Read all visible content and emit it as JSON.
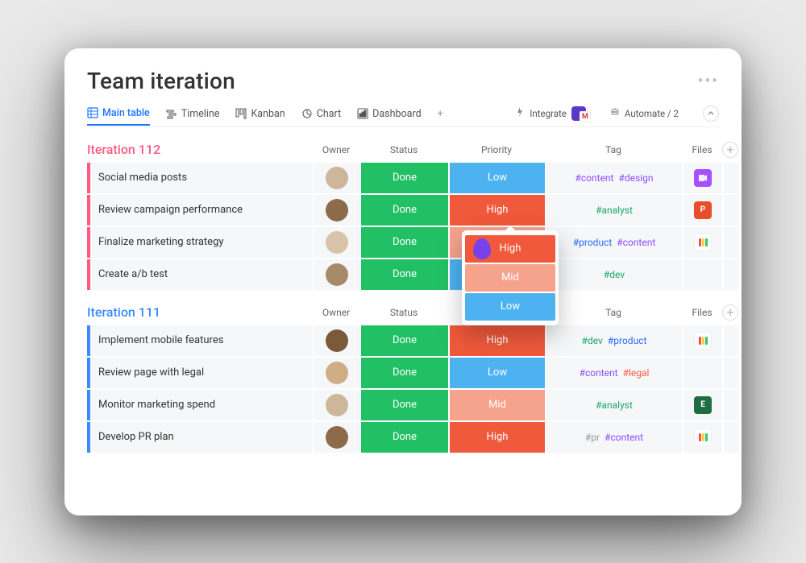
{
  "header": {
    "title": "Team iteration"
  },
  "tabs": {
    "main": "Main table",
    "timeline": "Timeline",
    "kanban": "Kanban",
    "chart": "Chart",
    "dashboard": "Dashboard"
  },
  "toolbar": {
    "integrate": "Integrate",
    "automate": "Automate / 2"
  },
  "columns": {
    "owner": "Owner",
    "status": "Status",
    "priority": "Priority",
    "tag": "Tag",
    "files": "Files"
  },
  "priority_options": {
    "high": "High",
    "mid": "Mid",
    "low": "Low"
  },
  "groups": [
    {
      "id": "g112",
      "title": "Iteration 112",
      "rows": [
        {
          "task": "Social media posts",
          "status": "Done",
          "priority": "Low",
          "prioClass": "p-low",
          "tags": [
            [
              "#content",
              "t-content"
            ],
            [
              "#design",
              "t-design"
            ]
          ],
          "file": "vid"
        },
        {
          "task": "Review campaign performance",
          "status": "Done",
          "priority": "High",
          "prioClass": "p-high",
          "tags": [
            [
              "#analyst",
              "t-analyst"
            ]
          ],
          "file": "ppt"
        },
        {
          "task": "Finalize marketing strategy",
          "status": "Done",
          "priority": "Mid",
          "prioClass": "p-mid",
          "tags": [
            [
              "#product",
              "t-product"
            ],
            [
              "#content",
              "t-content"
            ]
          ],
          "file": "mnd"
        },
        {
          "task": "Create a/b test",
          "status": "Done",
          "priority": "Low",
          "prioClass": "p-low",
          "tags": [
            [
              "#dev",
              "t-dev"
            ]
          ],
          "file": ""
        }
      ]
    },
    {
      "id": "g111",
      "title": "Iteration 111",
      "rows": [
        {
          "task": "Implement mobile features",
          "status": "Done",
          "priority": "High",
          "prioClass": "p-high",
          "tags": [
            [
              "#dev",
              "t-dev"
            ],
            [
              "#product",
              "t-product"
            ]
          ],
          "file": "mnd"
        },
        {
          "task": "Review page with legal",
          "status": "Done",
          "priority": "Low",
          "prioClass": "p-low",
          "tags": [
            [
              "#content",
              "t-content"
            ],
            [
              "#legal",
              "t-legal"
            ]
          ],
          "file": ""
        },
        {
          "task": "Monitor marketing spend",
          "status": "Done",
          "priority": "Mid",
          "prioClass": "p-mid",
          "tags": [
            [
              "#analyst",
              "t-analyst"
            ]
          ],
          "file": "xls"
        },
        {
          "task": "Develop PR plan",
          "status": "Done",
          "priority": "High",
          "prioClass": "p-high",
          "tags": [
            [
              "#pr",
              "t-pr"
            ],
            [
              "#content",
              "t-content"
            ]
          ],
          "file": "mnd"
        }
      ]
    }
  ]
}
